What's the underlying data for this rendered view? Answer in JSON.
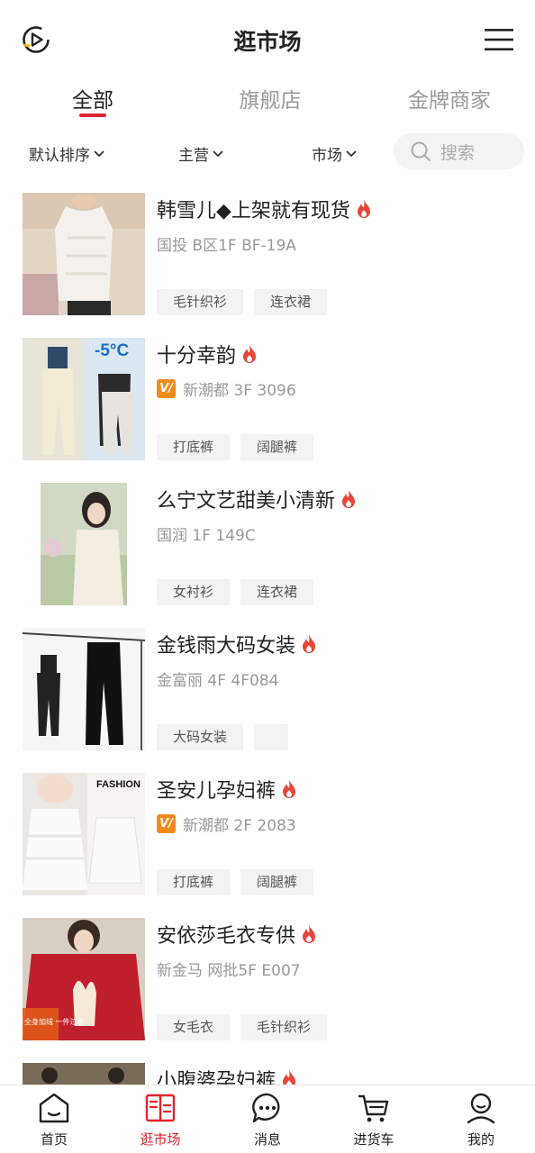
{
  "header": {
    "title": "逛市场",
    "left_icon": "play-circle-icon",
    "right_icon": "menu-icon"
  },
  "tabs": [
    {
      "label": "全部",
      "active": true
    },
    {
      "label": "旗舰店",
      "active": false
    },
    {
      "label": "金牌商家",
      "active": false
    }
  ],
  "filters": {
    "sort_label": "默认排序",
    "category_label": "主营",
    "market_label": "市场",
    "search_placeholder": "搜索"
  },
  "items": [
    {
      "name": "韩雪儿◆上架就有现货",
      "location": "国投 B区1F BF-19A",
      "vip": false,
      "tags": [
        "毛针织衫",
        "连衣裙"
      ]
    },
    {
      "name": "十分幸韵",
      "location": "新潮都 3F 3096",
      "vip": true,
      "tags": [
        "打底裤",
        "阔腿裤"
      ]
    },
    {
      "name": "么宁文艺甜美小清新",
      "location": "国润 1F 149C",
      "vip": false,
      "tags": [
        "女衬衫",
        "连衣裙"
      ]
    },
    {
      "name": "金钱雨大码女装",
      "location": "金富丽 4F 4F084",
      "vip": false,
      "tags": [
        "大码女装",
        ""
      ]
    },
    {
      "name": "圣安儿孕妇裤",
      "location": "新潮都 2F 2083",
      "vip": true,
      "tags": [
        "打底裤",
        "阔腿裤"
      ]
    },
    {
      "name": "安依莎毛衣专供",
      "location": "新金马 网批5F E007",
      "vip": false,
      "tags": [
        "女毛衣",
        "毛针织衫"
      ]
    },
    {
      "name": "小腹婆孕妇裤",
      "location": "",
      "vip": false,
      "tags": []
    }
  ],
  "thumb_text": {
    "item2_temp": "-5°C",
    "item5_brand": "FASHION",
    "item6_badge": "全身加绒 一件过冬"
  },
  "bottom_nav": [
    {
      "label": "首页",
      "icon": "home-icon",
      "active": false
    },
    {
      "label": "逛市场",
      "icon": "market-icon",
      "active": true
    },
    {
      "label": "消息",
      "icon": "message-icon",
      "active": false
    },
    {
      "label": "进货车",
      "icon": "cart-icon",
      "active": false
    },
    {
      "label": "我的",
      "icon": "profile-icon",
      "active": false
    }
  ],
  "colors": {
    "accent": "#e0252c",
    "flame": "#e8463a",
    "vip": "#f28b1c",
    "tag_bg": "#f3f3f3"
  }
}
